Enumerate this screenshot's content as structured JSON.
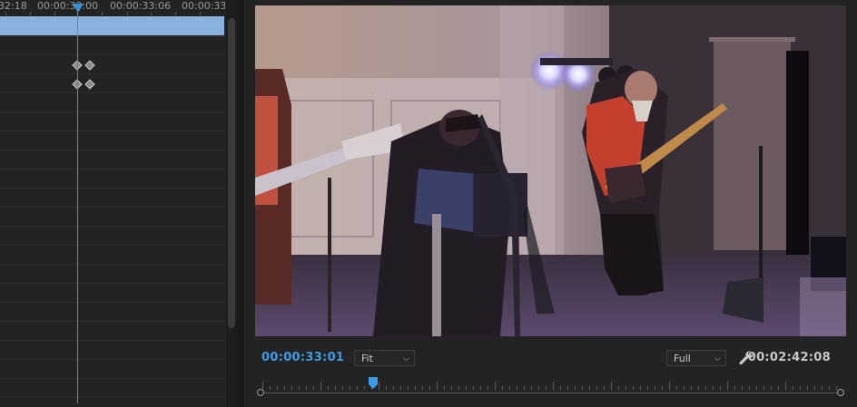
{
  "timeline": {
    "ruler_labels": [
      "32:18",
      "00:00:33:00",
      "00:00:33:06",
      "00:00:33"
    ],
    "keyframe_rows": 2
  },
  "monitor": {
    "current_timecode": "00:00:33:01",
    "zoom_select": "Fit",
    "resolution_select": "Full",
    "duration_timecode": "00:02:42:08",
    "video_description_icon": "video-frame"
  },
  "colors": {
    "accent_blue": "#3c9be6",
    "clip_bar": "#8ab2de",
    "panel_bg": "#232323"
  }
}
